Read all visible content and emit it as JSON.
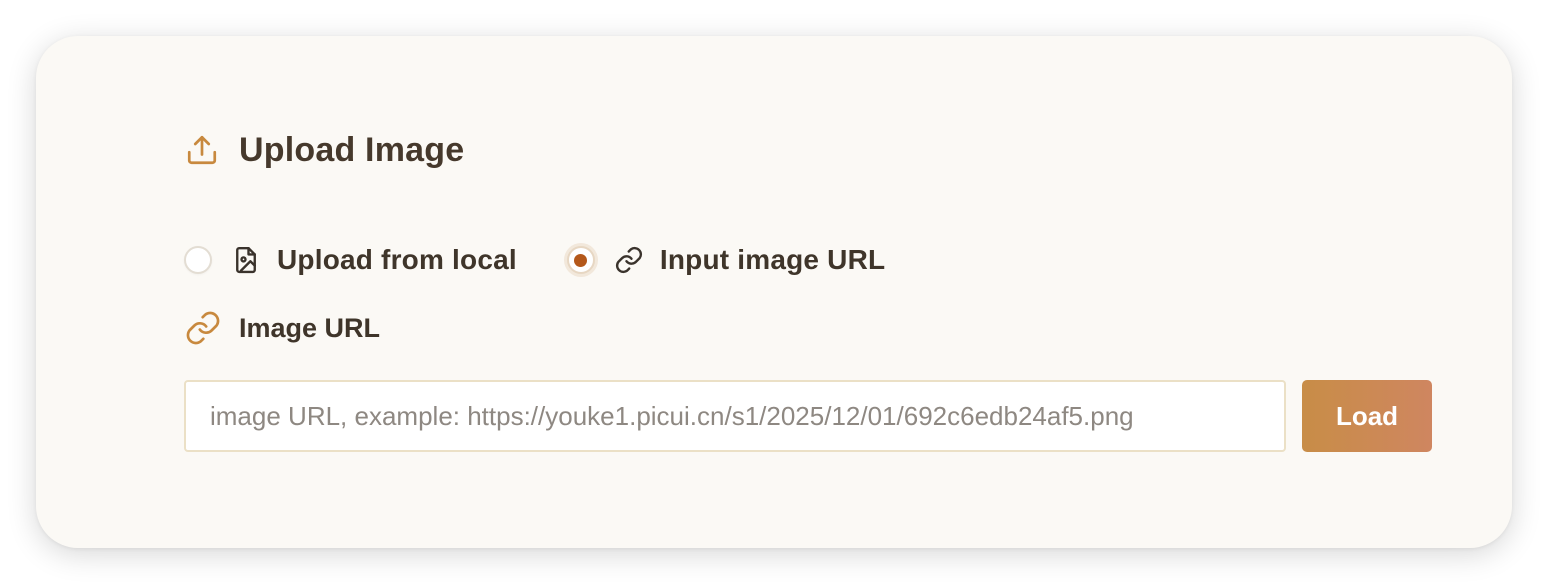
{
  "header": {
    "title": "Upload Image",
    "icon": "upload-icon"
  },
  "upload_mode": {
    "options": [
      {
        "label": "Upload from local",
        "icon": "image-file-icon",
        "selected": false
      },
      {
        "label": "Input image URL",
        "icon": "link-icon",
        "selected": true
      }
    ]
  },
  "url_field": {
    "label": "Image URL",
    "icon": "link-icon",
    "value": "",
    "placeholder": "image URL, example: https://youke1.picui.cn/s1/2025/12/01/692c6edb24af5.png"
  },
  "load_button": {
    "label": "Load"
  },
  "colors": {
    "accent": "#c88d47",
    "radio_selected": "#b4581a",
    "title_text": "#46392c",
    "card_background": "#fbf9f5"
  }
}
